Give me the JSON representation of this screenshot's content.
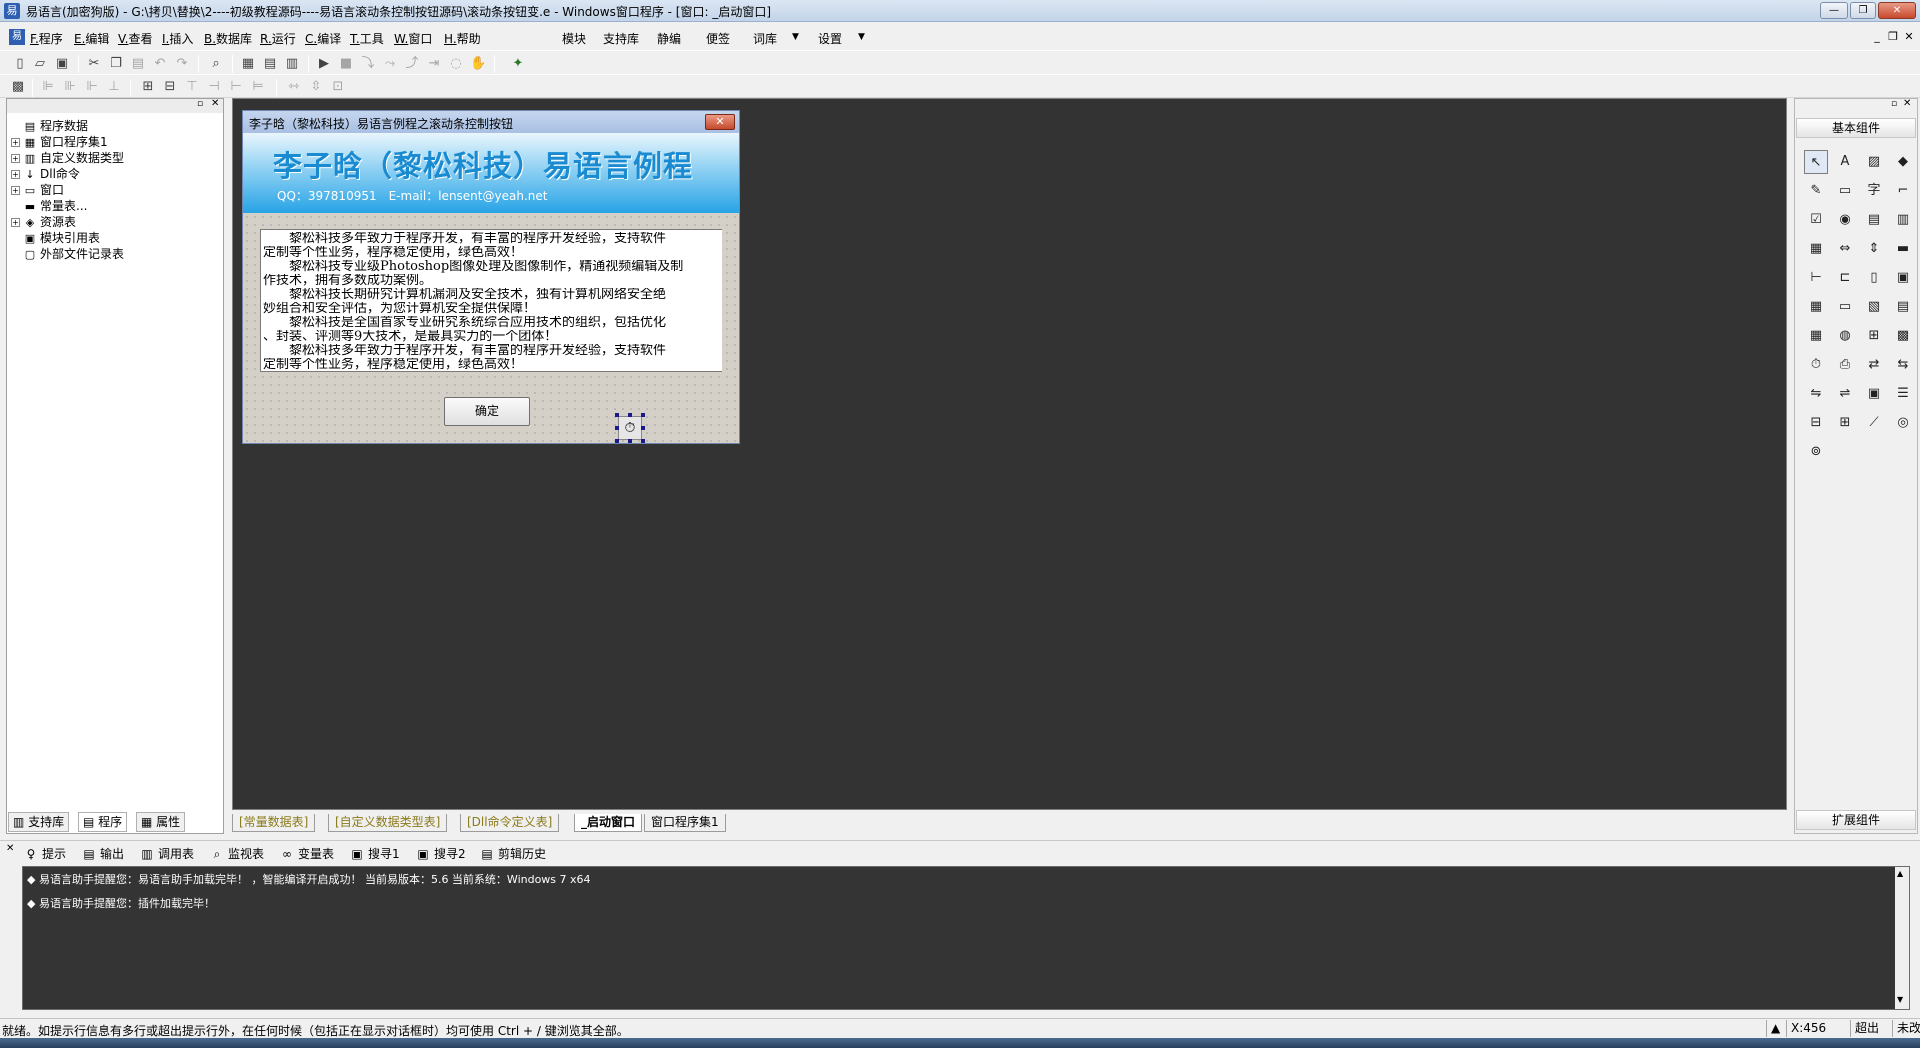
{
  "titlebar": {
    "title": "易语言(加密狗版) - G:\\拷贝\\替换\\2----初级教程源码----易语言滚动条控制按钮源码\\滚动条按钮变.e - Windows窗口程序 - [窗口: _启动窗口]",
    "minimize": "—",
    "restore": "❐",
    "close": "✕"
  },
  "menubar": {
    "items": [
      "F.程序",
      "E.编辑",
      "V.查看",
      "I.插入",
      "B.数据库",
      "R.运行",
      "C.编译",
      "T.工具",
      "W.窗口",
      "H.帮助"
    ],
    "extra": [
      "模块",
      "支持库",
      "静编",
      "便签",
      "词库",
      "设置"
    ],
    "dropdown_arrow": "▼",
    "mdi_min": "_",
    "mdi_restore": "❐",
    "mdi_close": "✕"
  },
  "left_panel": {
    "tree": [
      {
        "label": "程序数据",
        "icon": "program-data-icon",
        "glyph": "▤",
        "plus": false
      },
      {
        "label": "窗口程序集1",
        "icon": "assembly-icon",
        "glyph": "▦",
        "plus": true
      },
      {
        "label": "自定义数据类型",
        "icon": "datatype-icon",
        "glyph": "▥",
        "plus": true
      },
      {
        "label": "Dll命令",
        "icon": "dll-icon",
        "glyph": "↓",
        "plus": true
      },
      {
        "label": "窗口",
        "icon": "window-icon",
        "glyph": "▭",
        "plus": true
      },
      {
        "label": "常量表...",
        "icon": "constant-icon",
        "glyph": "▬",
        "plus": false
      },
      {
        "label": "资源表",
        "icon": "resource-icon",
        "glyph": "◈",
        "plus": true
      },
      {
        "label": "模块引用表",
        "icon": "module-icon",
        "glyph": "▣",
        "plus": false
      },
      {
        "label": "外部文件记录表",
        "icon": "external-file-icon",
        "glyph": "▢",
        "plus": false
      }
    ],
    "tabs": [
      "支持库",
      "程序",
      "属性"
    ]
  },
  "form": {
    "caption": "李子晗（黎松科技）易语言例程之滚动条控制按钮",
    "close": "✕",
    "banner_title": "李子晗（黎松科技）易语言例程",
    "banner_contact": "QQ：397810951　E-mail：lensent@yeah.net",
    "text_lines": [
      "　　黎松科技多年致力于程序开发，有丰富的程序开发经验，支持软件",
      "定制等个性业务，程序稳定使用，绿色高效！",
      "　　黎松科技专业级Photoshop图像处理及图像制作，精通视频编辑及制",
      "作技术，拥有多数成功案例。",
      "　　黎松科技长期研究计算机漏洞及安全技术，独有计算机网络安全绝",
      "妙组合和安全评估，为您计算机安全提供保障！",
      "　　黎松科技是全国首家专业研究系统综合应用技术的组织，包括优化",
      "、封装、评测等9大技术，是最具实力的一个团体！",
      "　　黎松科技多年致力于程序开发，有丰富的程序开发经验，支持软件",
      "定制等个性业务，程序稳定使用，绿色高效！"
    ],
    "ok_button": "确定",
    "timer_glyph": "⏱"
  },
  "editor_tabs": [
    "[常量数据表]",
    "[自定义数据类型表]",
    "[Dll命令定义表]",
    "_启动窗口",
    "窗口程序集1"
  ],
  "right_panel": {
    "header": "基本组件",
    "footer": "扩展组件",
    "components": [
      {
        "name": "pointer-icon",
        "glyph": "↖"
      },
      {
        "name": "label-icon",
        "glyph": "A"
      },
      {
        "name": "picture-box-icon",
        "glyph": "▨"
      },
      {
        "name": "shape-icon",
        "glyph": "◆"
      },
      {
        "name": "editbox-icon",
        "glyph": "✎"
      },
      {
        "name": "button-icon",
        "glyph": "▭"
      },
      {
        "name": "text-icon",
        "glyph": "字"
      },
      {
        "name": "line-icon",
        "glyph": "⌐"
      },
      {
        "name": "checkbox-icon",
        "glyph": "☑"
      },
      {
        "name": "radio-icon",
        "glyph": "◉"
      },
      {
        "name": "listbox-icon",
        "glyph": "▤"
      },
      {
        "name": "combobox-icon",
        "glyph": "▥"
      },
      {
        "name": "grid-icon",
        "glyph": "▦"
      },
      {
        "name": "hscroll-icon",
        "glyph": "⇔"
      },
      {
        "name": "vscroll-icon",
        "glyph": "⇕"
      },
      {
        "name": "progress-icon",
        "glyph": "▬"
      },
      {
        "name": "slider-icon",
        "glyph": "⊢"
      },
      {
        "name": "tab-control-icon",
        "glyph": "⊏"
      },
      {
        "name": "frame-icon",
        "glyph": "▯"
      },
      {
        "name": "image-list-icon",
        "glyph": "▣"
      },
      {
        "name": "date-box-icon",
        "glyph": "▦"
      },
      {
        "name": "calendar-icon",
        "glyph": "▭"
      },
      {
        "name": "folder-icon",
        "glyph": "▧"
      },
      {
        "name": "file-icon",
        "glyph": "▤"
      },
      {
        "name": "table-icon",
        "glyph": "▦"
      },
      {
        "name": "db-icon",
        "glyph": "◍"
      },
      {
        "name": "ruler-icon",
        "glyph": "⊞"
      },
      {
        "name": "calc-icon",
        "glyph": "▩"
      },
      {
        "name": "timer-icon",
        "glyph": "⏱"
      },
      {
        "name": "printer-icon",
        "glyph": "⎙"
      },
      {
        "name": "network-icon",
        "glyph": "⇄"
      },
      {
        "name": "server-icon",
        "glyph": "⇆"
      },
      {
        "name": "client-icon",
        "glyph": "⇋"
      },
      {
        "name": "socket-icon",
        "glyph": "⇌"
      },
      {
        "name": "window-ctl-icon",
        "glyph": "▣"
      },
      {
        "name": "menu-icon",
        "glyph": "☰"
      },
      {
        "name": "tree-ctl-icon",
        "glyph": "⊟"
      },
      {
        "name": "list-ctl-icon",
        "glyph": "⊞"
      },
      {
        "name": "chart-icon",
        "glyph": "⟋"
      },
      {
        "name": "odbc-icon",
        "glyph": "◎"
      },
      {
        "name": "odbc2-icon",
        "glyph": "⊚"
      }
    ]
  },
  "output_tabs": [
    {
      "label": "提示",
      "glyph": "♀"
    },
    {
      "label": "输出",
      "glyph": "▤"
    },
    {
      "label": "调用表",
      "glyph": "▥"
    },
    {
      "label": "监视表",
      "glyph": "⌕"
    },
    {
      "label": "变量表",
      "glyph": "∞"
    },
    {
      "label": "搜寻1",
      "glyph": "▣"
    },
    {
      "label": "搜寻2",
      "glyph": "▣"
    },
    {
      "label": "剪辑历史",
      "glyph": "▤"
    }
  ],
  "output_lines": [
    "◆ 易语言助手提醒您：易语言助手加载完毕！ ，智能编译开启成功！ 当前易版本：5.6  当前系统：Windows 7 x64",
    "◆ 易语言助手提醒您：插件加载完毕！"
  ],
  "statusbar": {
    "text": "就绪。如提示行信息有多行或超出提示行外，在任何时候（包括正在显示对话框时）均可使用 Ctrl + / 键浏览其全部。",
    "coord": "X:456",
    "mode": "超出",
    "save_state": "未改"
  }
}
